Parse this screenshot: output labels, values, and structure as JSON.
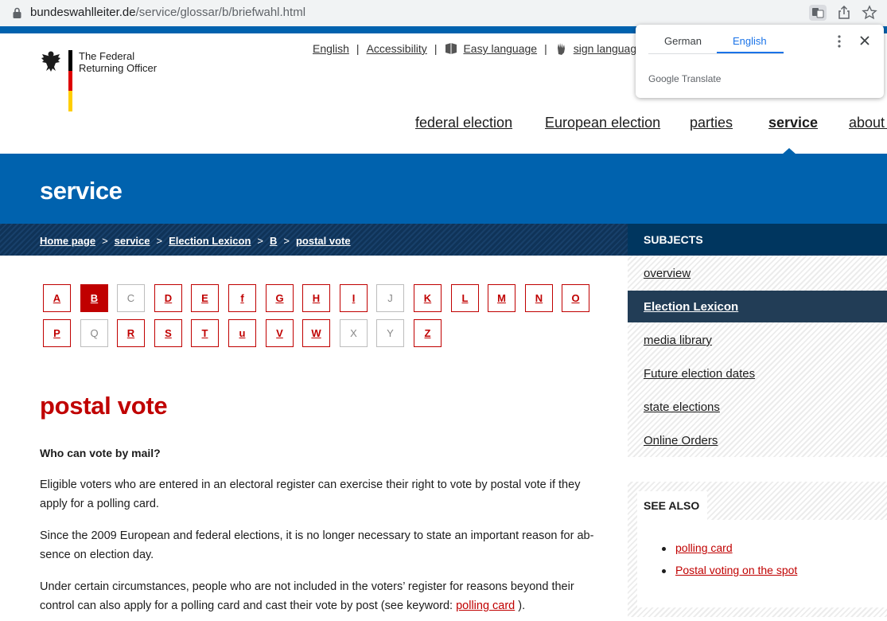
{
  "browser": {
    "url_host": "bundeswahlleiter.de",
    "url_path": "/service/glossar/b/briefwahl.html"
  },
  "translate_popup": {
    "lang_from": "German",
    "lang_to": "English",
    "brand": "Google Translate"
  },
  "header": {
    "logo_line1": "The Federal",
    "logo_line2": "Returning Officer",
    "flag_colors": [
      "#000000",
      "#dd0000",
      "#ffce00"
    ],
    "top_links": {
      "english": "English",
      "accessibility": "Accessibility",
      "easy_language": "Easy language",
      "sign_language": "sign language",
      "separator": "|"
    },
    "nav": [
      {
        "label": "federal election"
      },
      {
        "label": "European election"
      },
      {
        "label": "parties"
      },
      {
        "label": "service"
      },
      {
        "label": "about u"
      }
    ]
  },
  "band": {
    "title": "service"
  },
  "breadcrumb": {
    "items": [
      "Home page",
      "service",
      "Election Lexicon",
      "B",
      "postal vote"
    ],
    "separator": ">"
  },
  "letters": {
    "row1": [
      "A",
      "B",
      "C",
      "D",
      "E",
      "f",
      "G",
      "H",
      "I",
      "J",
      "K",
      "L",
      "M",
      "N",
      "O"
    ],
    "row2": [
      "P",
      "Q",
      "R",
      "S",
      "T",
      "u",
      "V",
      "W",
      "X",
      "Y",
      "Z"
    ],
    "active": "B",
    "disabled": [
      "C",
      "J",
      "Q",
      "X",
      "Y"
    ]
  },
  "content": {
    "heading": "postal vote",
    "question": "Who can vote by mail?",
    "p1": "Eligible voters who are entered in an electoral register can exercise their right to vote by postal vote if they apply for a polling card.",
    "p2": "Since the 2009 European and federal elections, it is no longer necessary to state an important reason for ab-sence on election day.",
    "p3_before": "Under certain circumstances, people who are not included in the voters’ register for reasons beyond their control can also apply for a polling card and cast their vote by post (see keyword: ",
    "p3_link": "polling card",
    "p3_after": " )."
  },
  "sidebar": {
    "head": "SUBJECTS",
    "items": [
      {
        "label": "overview"
      },
      {
        "label": "Election Lexicon"
      },
      {
        "label": "media library"
      },
      {
        "label": "Future election dates"
      },
      {
        "label": "state elections"
      },
      {
        "label": "Online Orders"
      }
    ],
    "active_item": "Election Lexicon"
  },
  "see_also": {
    "title": "SEE ALSO",
    "links": [
      "polling card",
      "Postal voting on the spot"
    ]
  },
  "colors": {
    "brand_blue": "#0062ae",
    "navy": "#00365f",
    "accent_red": "#c00000"
  }
}
